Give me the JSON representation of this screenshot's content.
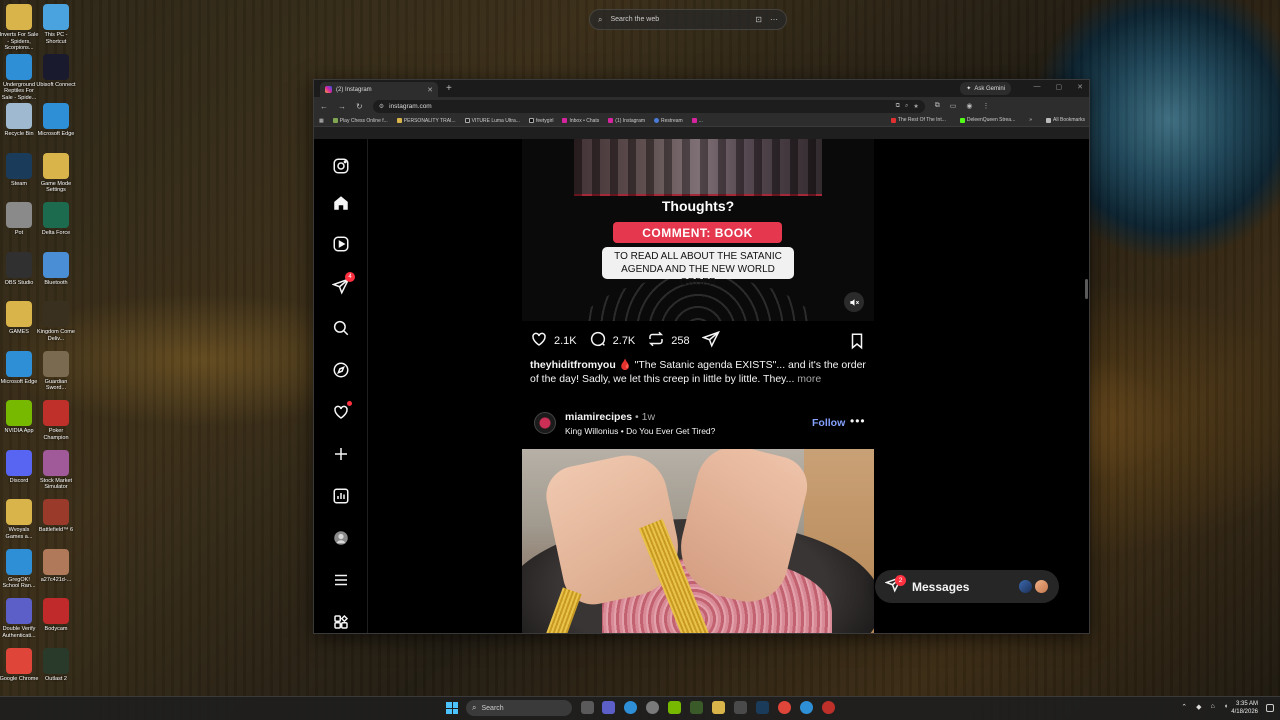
{
  "desktop": {
    "icons_left": [
      {
        "label": "Inverts For Sale - Spiders, Scorpions...",
        "icon": "folder-icon",
        "color": "#d9b44a"
      },
      {
        "label": "Underground Reptiles For Sale - Spide...",
        "icon": "edge-icon",
        "color": "#2e8fd6"
      },
      {
        "label": "Recycle Bin",
        "icon": "recycle-bin-icon",
        "color": "#9fb9d0"
      },
      {
        "label": "Steam",
        "icon": "steam-icon",
        "color": "#1b3b5a"
      },
      {
        "label": "Pot",
        "icon": "app-icon",
        "color": "#8a8a8a"
      },
      {
        "label": "OBS Studio",
        "icon": "obs-icon",
        "color": "#303030"
      },
      {
        "label": "GAMES",
        "icon": "folder-icon",
        "color": "#d9b44a"
      },
      {
        "label": "Microsoft Edge",
        "icon": "edge-icon",
        "color": "#2e8fd6"
      },
      {
        "label": "NVIDIA App",
        "icon": "nvidia-icon",
        "color": "#76b900"
      },
      {
        "label": "Discord",
        "icon": "discord-icon",
        "color": "#5865f2"
      },
      {
        "label": "Wvoyals Games a...",
        "icon": "folder-icon",
        "color": "#d9b44a"
      },
      {
        "label": "GregOK! School Ran...",
        "icon": "edge-icon",
        "color": "#2e8fd6"
      },
      {
        "label": "Double Verify Authenticati...",
        "icon": "shield-icon",
        "color": "#5b5fc7"
      },
      {
        "label": "Google Chrome",
        "icon": "chrome-icon",
        "color": "#e0453a"
      }
    ],
    "icons_right": [
      {
        "label": "This PC - Shortcut",
        "icon": "computer-icon",
        "color": "#4aa3df"
      },
      {
        "label": "Ubisoft Connect",
        "icon": "ubisoft-icon",
        "color": "#1a1a2e"
      },
      {
        "label": "Microsoft Edge",
        "icon": "edge-icon",
        "color": "#2e8fd6"
      },
      {
        "label": "Game Mode Settings",
        "icon": "folder-icon",
        "color": "#d9b44a"
      },
      {
        "label": "Delta Force",
        "icon": "delta-force-icon",
        "color": "#1d6b4f"
      },
      {
        "label": "Bluetooth",
        "icon": "bluetooth-icon",
        "color": "#4a8fd6"
      },
      {
        "label": "Kingdom Come Deliv...",
        "icon": "kcd-icon",
        "color": "#3a3020"
      },
      {
        "label": "Guardian Sword...",
        "icon": "game-icon",
        "color": "#7a6a50"
      },
      {
        "label": "Poker Champion",
        "icon": "poker-icon",
        "color": "#c0302a"
      },
      {
        "label": "Stock Market Simulator",
        "icon": "game-icon",
        "color": "#a05a9a"
      },
      {
        "label": "Battlefield™ 6",
        "icon": "battlefield-icon",
        "color": "#9a3a2a"
      },
      {
        "label": "a27c421d-...",
        "icon": "image-icon",
        "color": "#b07a5a"
      },
      {
        "label": "Bodycam",
        "icon": "bodycam-icon",
        "color": "#c02a2a"
      },
      {
        "label": "Outlast 2",
        "icon": "outlast-icon",
        "color": "#2a3a2a"
      }
    ],
    "websearch_placeholder": "Search the web"
  },
  "browser": {
    "tab_title": "(2) Instagram",
    "tab_close": "✕",
    "new_tab": "+",
    "gemini_label": "Ask Gemini",
    "window_controls": [
      "—",
      "▢",
      "✕"
    ],
    "url": "instagram.com",
    "bookmarks": [
      "Play Chess Online f...",
      "PERSONALITY TRAI...",
      "VITURE Luma Ultra...",
      "feetygirl",
      "Inbox • Chats",
      "(1) Instagram",
      "Restream",
      "..."
    ],
    "bookmarks_right": [
      "The Rest Of The Int...",
      "DeleenQueen Strea...",
      "»",
      "All Bookmarks"
    ]
  },
  "instagram": {
    "nav_badge_count": "4",
    "post1": {
      "overlay_title": "Thoughts?",
      "overlay_cta": "COMMENT: BOOK",
      "overlay_sub": "TO READ ALL ABOUT THE SATANIC AGENDA AND THE NEW WORLD ORDER",
      "likes": "2.1K",
      "comments": "2.7K",
      "reposts": "258",
      "caption_user": "theyhiditfromyou",
      "caption_emoji": "🩸",
      "caption_text": " \"The Satanic agenda EXISTS\"... and it's the order of the day! Sadly, we let this creep in little by little. They...",
      "caption_more": " more"
    },
    "post2": {
      "username": "miamirecipes",
      "time": " • 1w",
      "audio": "King Willonius • Do You Ever Get Tired?",
      "follow": "Follow",
      "more": "•••"
    },
    "messages": {
      "label": "Messages",
      "badge": "2"
    }
  },
  "taskbar": {
    "search_placeholder": "Search",
    "time": "3:35 AM",
    "date": "4/18/2026"
  }
}
